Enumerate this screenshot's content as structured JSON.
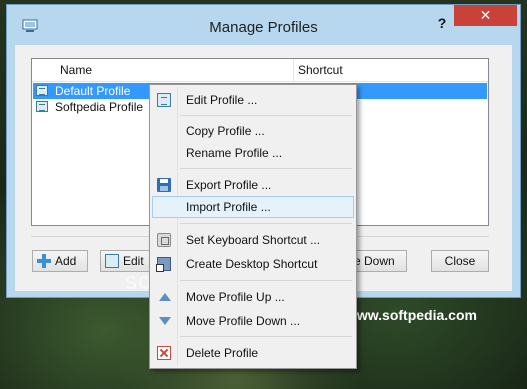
{
  "window": {
    "title": "Manage Profiles",
    "help_label": "?",
    "close_label": "✕"
  },
  "list": {
    "columns": [
      "Name",
      "Shortcut"
    ],
    "rows": [
      {
        "name": "Default Profile",
        "shortcut": "",
        "selected": true
      },
      {
        "name": "Softpedia Profile",
        "shortcut": "",
        "selected": false
      }
    ]
  },
  "buttons": {
    "add": "Add",
    "edit": "Edit",
    "move_down": "e Down",
    "close": "Close"
  },
  "context_menu": {
    "items": [
      {
        "label": "Edit Profile ...",
        "icon": "profile-icon"
      },
      {
        "label": "Copy Profile ...",
        "icon": ""
      },
      {
        "label": "Rename Profile ...",
        "icon": ""
      },
      {
        "label": "Export Profile ...",
        "icon": "save-icon"
      },
      {
        "label": "Import Profile ...",
        "icon": "",
        "highlighted": true
      },
      {
        "label": "Set Keyboard Shortcut ...",
        "icon": "keyboard-icon"
      },
      {
        "label": "Create Desktop Shortcut",
        "icon": "desktop-shortcut-icon"
      },
      {
        "label": "Move Profile Up ...",
        "icon": "arrow-up-icon"
      },
      {
        "label": "Move Profile Down ...",
        "icon": "arrow-down-icon"
      },
      {
        "label": "Delete Profile",
        "icon": "delete-icon"
      }
    ]
  },
  "watermark": {
    "url": "www.softpedia.com",
    "faint": "SOFTPE"
  }
}
